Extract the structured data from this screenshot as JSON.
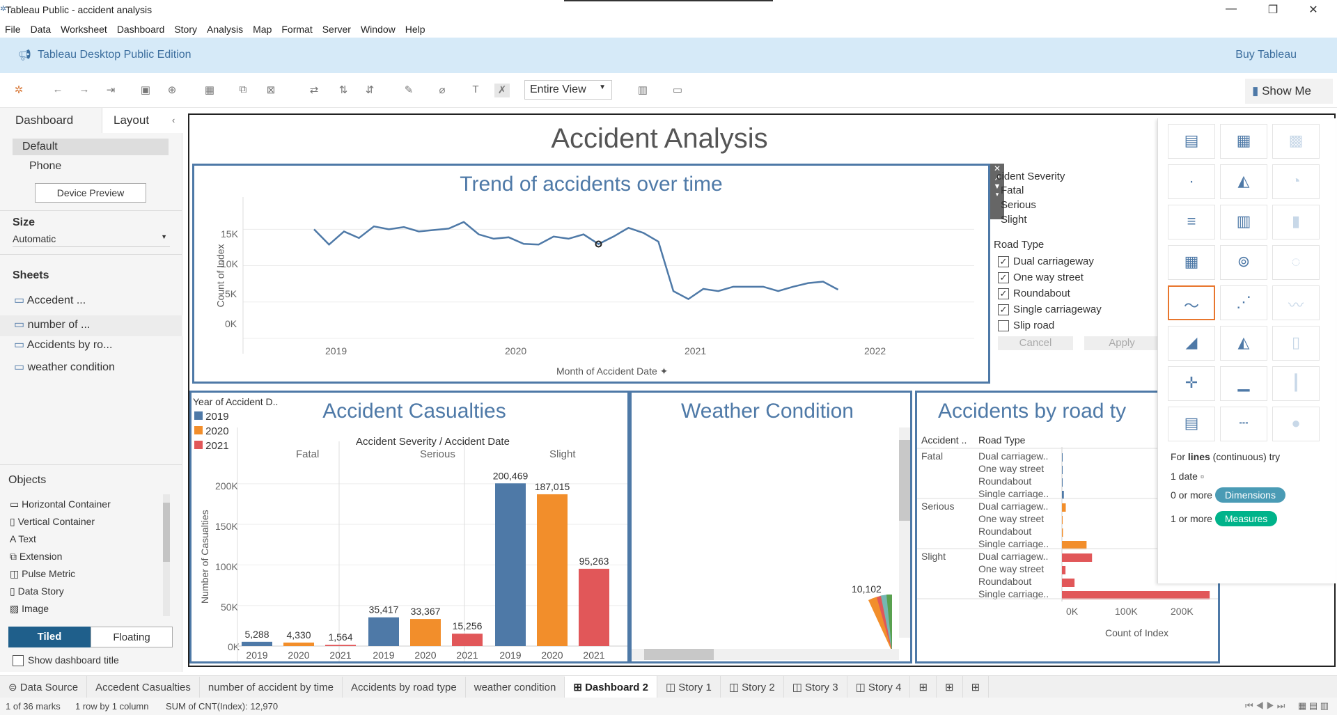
{
  "window": {
    "title": "Tableau Public - accident analysis"
  },
  "menu": [
    "File",
    "Data",
    "Worksheet",
    "Dashboard",
    "Story",
    "Analysis",
    "Map",
    "Format",
    "Server",
    "Window",
    "Help"
  ],
  "banner": {
    "title": "Tableau Desktop Public Edition",
    "buy": "Buy Tableau"
  },
  "toolbar": {
    "fit": "Entire View",
    "showme": "Show Me"
  },
  "left": {
    "tabs": [
      "Dashboard",
      "Layout"
    ],
    "devices": [
      "Default",
      "Phone"
    ],
    "device_preview": "Device Preview",
    "size_label": "Size",
    "size_value": "Automatic",
    "sheets_label": "Sheets",
    "sheets": [
      "Accedent ...",
      "number of ...",
      "Accidents by ro...",
      "weather condition"
    ],
    "objects_label": "Objects",
    "objects": [
      "Horizontal Container",
      "Vertical Container",
      "Text",
      "Extension",
      "Pulse Metric",
      "Data Story",
      "Image"
    ],
    "tiled": "Tiled",
    "floating": "Floating",
    "show_title": "Show dashboard title"
  },
  "dashboard": {
    "title": "Accident Analysis"
  },
  "trend": {
    "title": "Trend of accidents over time",
    "ylabel": "Count of Index",
    "xlabel": "Month of Accident Date",
    "yticks": [
      "15K",
      "10K",
      "5K",
      "0K"
    ],
    "xticks": [
      "2019",
      "2020",
      "2021",
      "2022"
    ]
  },
  "filters": {
    "severity_label": "cident Severity",
    "severity": [
      "Fatal",
      "Serious",
      "Slight"
    ],
    "road_label": "Road Type",
    "road": [
      {
        "label": "Dual carriageway",
        "checked": true
      },
      {
        "label": "One way street",
        "checked": true
      },
      {
        "label": "Roundabout",
        "checked": true
      },
      {
        "label": "Single carriageway",
        "checked": true
      },
      {
        "label": "Slip road",
        "checked": false
      }
    ],
    "cancel": "Cancel",
    "apply": "Apply"
  },
  "casualties": {
    "title": "Accident Casualties",
    "legend_title": "Year of Accident D..",
    "legend": [
      "2019",
      "2020",
      "2021"
    ],
    "header": "Accident Severity / Accident Date",
    "groups": [
      "Fatal",
      "Serious",
      "Slight"
    ],
    "ylabel": "Number of Casualties",
    "yticks": [
      "200K",
      "150K",
      "100K",
      "50K",
      "0K"
    ],
    "years": [
      "2019",
      "2020",
      "2021"
    ]
  },
  "weather": {
    "title": "Weather Condition",
    "label": "10,102"
  },
  "road": {
    "title": "Accidents by road ty",
    "col1": "Accident ..",
    "col2": "Road Type",
    "severities": [
      "Fatal",
      "Serious",
      "Slight"
    ],
    "types": [
      "Dual carriagew..",
      "One way street",
      "Roundabout",
      "Single carriage.."
    ],
    "xticks": [
      "0K",
      "100K",
      "200K"
    ],
    "xlabel": "Count of Index"
  },
  "showme": {
    "hint_pre": "For ",
    "hint_bold": "lines",
    "hint_post": " (continuous) try",
    "req1": "1 date",
    "req2": "0 or more",
    "req3": "1 or more",
    "dims": "Dimensions",
    "meas": "Measures"
  },
  "tabs": [
    "Data Source",
    "Accedent Casualties",
    "number of accident by time",
    "Accidents by road type",
    "weather condition",
    "Dashboard 2",
    "Story 1",
    "Story 2",
    "Story 3",
    "Story 4"
  ],
  "status": {
    "marks": "1 of 36 marks",
    "rows": "1 row by 1 column",
    "sum": "SUM of CNT(Index): 12,970"
  },
  "colors": {
    "blue": "#4e79a7",
    "orange": "#f28e2b",
    "red": "#e15759",
    "green": "#00b38a",
    "teal": "#4a9bb5"
  },
  "chart_data": [
    {
      "type": "line",
      "title": "Trend of accidents over time",
      "xlabel": "Month of Accident Date",
      "ylabel": "Count of Index",
      "ylim": [
        0,
        17000
      ],
      "x": [
        "2019-01",
        "2019-02",
        "2019-03",
        "2019-04",
        "2019-05",
        "2019-06",
        "2019-07",
        "2019-08",
        "2019-09",
        "2019-10",
        "2019-11",
        "2019-12",
        "2020-01",
        "2020-02",
        "2020-03",
        "2020-04",
        "2020-05",
        "2020-06",
        "2020-07",
        "2020-08",
        "2020-09",
        "2020-10",
        "2020-11",
        "2020-12",
        "2021-01",
        "2021-02",
        "2021-03",
        "2021-04",
        "2021-05",
        "2021-06",
        "2021-07",
        "2021-08",
        "2021-09",
        "2021-10",
        "2021-11",
        "2021-12"
      ],
      "values": [
        15000,
        12900,
        14700,
        13800,
        15400,
        15000,
        15300,
        14700,
        14900,
        15100,
        16000,
        14300,
        13700,
        13900,
        13000,
        12900,
        14000,
        13700,
        14300,
        12970,
        14000,
        15200,
        14500,
        13300,
        6500,
        5400,
        6800,
        6500,
        7100,
        7100,
        7100,
        6500,
        7100,
        7600,
        7800,
        6700
      ]
    },
    {
      "type": "bar",
      "title": "Accident Casualties",
      "ylabel": "Number of Casualties",
      "ylim": [
        0,
        220000
      ],
      "categories": [
        "Fatal",
        "Serious",
        "Slight"
      ],
      "series": [
        {
          "name": "2019",
          "values": [
            5288,
            35417,
            200469
          ]
        },
        {
          "name": "2020",
          "values": [
            4330,
            33367,
            187015
          ]
        },
        {
          "name": "2021",
          "values": [
            1564,
            15256,
            95263
          ]
        }
      ]
    },
    {
      "type": "pie",
      "title": "Weather Condition",
      "values": [
        10102
      ]
    },
    {
      "type": "bar",
      "title": "Accidents by road ty",
      "xlabel": "Count of Index",
      "xlim": [
        0,
        280000
      ],
      "categories": [
        "Dual carriagew..",
        "One way street",
        "Roundabout",
        "Single carriage.."
      ],
      "series": [
        {
          "name": "Fatal",
          "values": [
            800,
            200,
            300,
            3500
          ]
        },
        {
          "name": "Serious",
          "values": [
            7000,
            1300,
            1800,
            45000
          ]
        },
        {
          "name": "Slight",
          "values": [
            55000,
            6500,
            23000,
            270000
          ]
        }
      ]
    }
  ]
}
